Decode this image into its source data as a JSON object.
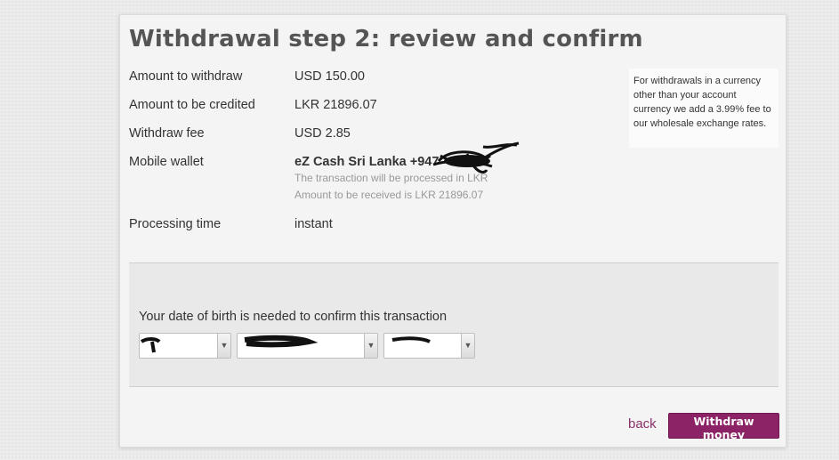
{
  "page": {
    "title": "Withdrawal step 2: review and confirm"
  },
  "details": [
    {
      "label": "Amount to withdraw",
      "value": "USD 150.00"
    },
    {
      "label": "Amount to be credited",
      "value": "LKR 21896.07"
    },
    {
      "label": "Withdraw fee",
      "value": "USD 2.85"
    },
    {
      "label": "Mobile wallet",
      "value": "eZ Cash Sri Lanka +947"
    },
    {
      "label": "Processing time",
      "value": "instant"
    }
  ],
  "wallet_notes": {
    "processed": "The transaction will be processed in LKR",
    "received": "Amount to be received is LKR 21896.07"
  },
  "info": {
    "text": "For withdrawals in a currency other than your account currency we add a 3.99% fee to our wholesale exchange rates."
  },
  "dob": {
    "label": "Your date of birth is needed to confirm this transaction",
    "day": "",
    "month": "",
    "year": ""
  },
  "actions": {
    "back": "back",
    "withdraw": "Withdraw money"
  },
  "colors": {
    "accent": "#8c2366",
    "link": "#8a2f6a"
  }
}
